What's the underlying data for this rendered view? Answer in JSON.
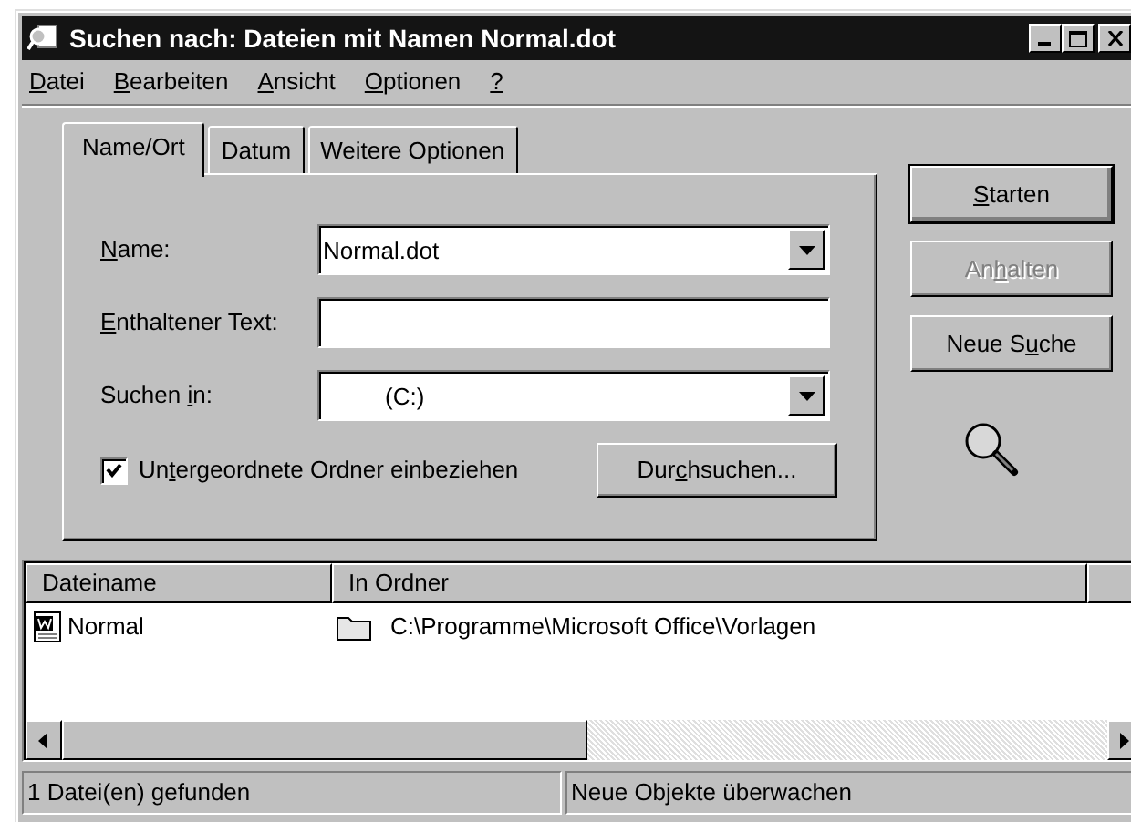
{
  "window": {
    "title": "Suchen nach: Dateien mit Namen Normal.dot"
  },
  "menu": [
    {
      "label": [
        {
          "text": "D",
          "underlined": true
        },
        {
          "text": "atei",
          "underlined": false
        }
      ]
    },
    {
      "label": [
        {
          "text": "B",
          "underlined": true
        },
        {
          "text": "earbeiten",
          "underlined": false
        }
      ]
    },
    {
      "label": [
        {
          "text": "A",
          "underlined": true
        },
        {
          "text": "nsicht",
          "underlined": false
        }
      ]
    },
    {
      "label": [
        {
          "text": "O",
          "underlined": true
        },
        {
          "text": "ptionen",
          "underlined": false
        }
      ]
    },
    {
      "label": [
        {
          "text": "?",
          "underlined": true
        }
      ]
    }
  ],
  "tabs": [
    {
      "label": "Name/Ort",
      "selected": true
    },
    {
      "label": "Datum",
      "selected": false
    },
    {
      "label": "Weitere Optionen",
      "selected": false
    }
  ],
  "fields": [
    {
      "kind": "combo",
      "label": [
        {
          "text": "N",
          "underlined": true
        },
        {
          "text": "ame:",
          "underlined": false
        }
      ],
      "value": "Normal.dot"
    },
    {
      "kind": "text",
      "label": [
        {
          "text": "E",
          "underlined": true
        },
        {
          "text": "nthaltener Text:",
          "underlined": false
        }
      ]
    },
    {
      "kind": "combo",
      "label": [
        {
          "text": "Suchen ",
          "underlined": false
        },
        {
          "text": "i",
          "underlined": true
        },
        {
          "text": "n:",
          "underlined": false
        }
      ],
      "value": "(C:)"
    }
  ],
  "subfolders": {
    "checked": true,
    "label": [
      {
        "text": "Un",
        "underlined": false
      },
      {
        "text": "t",
        "underlined": true
      },
      {
        "text": "ergeordnete Ordner einbeziehen",
        "underlined": false
      }
    ]
  },
  "browse_button": {
    "label": [
      {
        "text": "Dur",
        "underlined": false
      },
      {
        "text": "c",
        "underlined": true
      },
      {
        "text": "hsuchen...",
        "underlined": false
      }
    ]
  },
  "buttons": [
    {
      "label": [
        {
          "text": "S",
          "underlined": true
        },
        {
          "text": "tarten",
          "underlined": false
        }
      ],
      "default": true,
      "disabled": false
    },
    {
      "label": [
        {
          "text": "An",
          "underlined": false
        },
        {
          "text": "h",
          "underlined": true
        },
        {
          "text": "alten",
          "underlined": false
        }
      ],
      "default": false,
      "disabled": true
    },
    {
      "label": [
        {
          "text": "Neue S",
          "underlined": false
        },
        {
          "text": "u",
          "underlined": true
        },
        {
          "text": "che",
          "underlined": false
        }
      ],
      "default": false,
      "disabled": false
    }
  ],
  "table": {
    "columns": [
      "Dateiname",
      "In Ordner"
    ],
    "rows": [
      {
        "name": "Normal",
        "folder": "C:\\Programme\\Microsoft Office\\Vorlagen"
      }
    ]
  },
  "status_bar": [
    "1 Datei(en) gefunden",
    "Neue Objekte überwachen"
  ]
}
